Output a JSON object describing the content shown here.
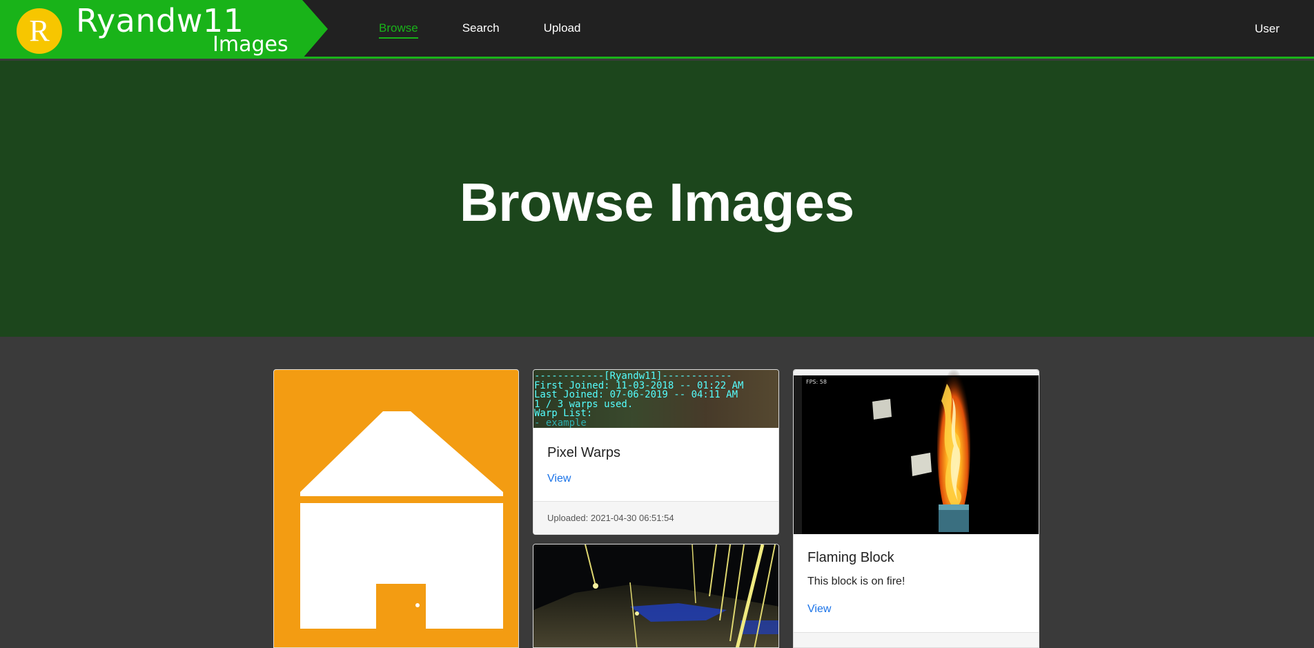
{
  "brand": {
    "logo_letter": "R",
    "title": "Ryandw11",
    "subtitle": "Images"
  },
  "nav": {
    "browse": "Browse",
    "search": "Search",
    "upload": "Upload",
    "user": "User"
  },
  "hero": {
    "heading": "Browse Images"
  },
  "cards": {
    "pixel_warps": {
      "title": "Pixel Warps",
      "view": "View",
      "uploaded": "Uploaded: 2021-04-30 06:51:54",
      "screenshot_lines": [
        "------------[Ryandw11]------------",
        "First Joined: 11-03-2018 -- 01:22 AM",
        "Last Joined: 07-06-2019 -- 04:11 AM",
        "1 / 3 warps used.",
        "Warp List:",
        "- example"
      ]
    },
    "flaming_block": {
      "title": "Flaming Block",
      "description": "This block is on fire!",
      "view": "View",
      "fps": "FPS: 58"
    }
  },
  "colors": {
    "accent": "#19b319",
    "hero_bg": "#1c461c",
    "body_bg": "#3a3a3a",
    "header_bg": "#212121",
    "link": "#1a73e8",
    "logo_yellow": "#f7c600",
    "tile_orange": "#f39c12"
  },
  "icons": {
    "home_tile": "house-icon"
  }
}
